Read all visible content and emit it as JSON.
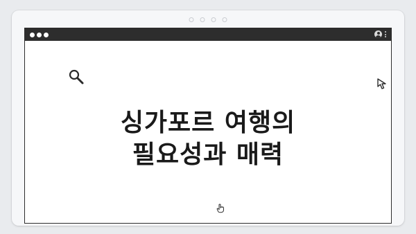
{
  "content": {
    "headline_line1": "싱가포르 여행의",
    "headline_line2": "필요성과 매력"
  },
  "icons": {
    "search": "search-icon",
    "cursor": "cursor-arrow-icon",
    "hand": "hand-pointer-icon",
    "profile": "profile-icon",
    "menu": "kebab-menu-icon"
  },
  "colors": {
    "background": "#e9ebee",
    "device": "#f6f7f9",
    "titlebar": "#2d2d2d",
    "text": "#1a1a1a"
  }
}
